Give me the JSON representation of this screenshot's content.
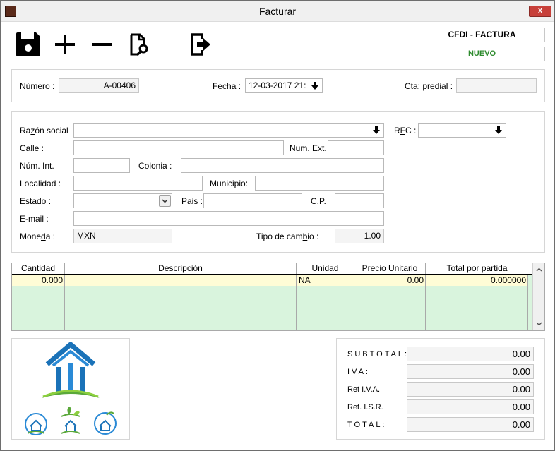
{
  "window": {
    "title": "Facturar",
    "close_label": "x"
  },
  "toolbar": {
    "save": "save-icon",
    "add": "plus-icon",
    "remove": "minus-icon",
    "preview": "document-search-icon",
    "exit": "exit-icon"
  },
  "doc": {
    "type": "CFDI - FACTURA",
    "status": "NUEVO",
    "status_color": "#2e8b2e"
  },
  "header": {
    "numero_label": "Número :",
    "numero_value": "A-00406",
    "fecha_label_pre": "Fec",
    "fecha_label_u": "h",
    "fecha_label_post": "a :",
    "fecha_value": "12-03-2017 21:",
    "cta_label_pre": "Cta: ",
    "cta_label_u": "p",
    "cta_label_post": "redial :",
    "cta_value": ""
  },
  "cliente": {
    "razon_label_pre": "Ra",
    "razon_label_u": "z",
    "razon_label_post": "ón social",
    "razon_value": "",
    "rfc_label_pre": "R",
    "rfc_label_u": "F",
    "rfc_label_post": "C :",
    "rfc_value": "",
    "calle_label": "Calle :",
    "calle_value": "",
    "numext_label": "Num. Ext.",
    "numext_value": "",
    "numint_label": "Núm. Int.",
    "numint_value": "",
    "colonia_label": "Colonia :",
    "colonia_value": "",
    "localidad_label": "Localidad :",
    "localidad_value": "",
    "municipio_label": "Municipio:",
    "municipio_value": "",
    "estado_label": "Estado :",
    "estado_value": "",
    "pais_label": "Pais :",
    "pais_value": "",
    "cp_label": "C.P.",
    "cp_value": "",
    "email_label": "E-mail :",
    "email_value": "",
    "moneda_label_pre": "Mone",
    "moneda_label_u": "d",
    "moneda_label_post": "a :",
    "moneda_value": "MXN",
    "tipo_label_pre": "Tipo de cam",
    "tipo_label_u": "b",
    "tipo_label_post": "io :",
    "tipo_value": "1.00"
  },
  "grid": {
    "columns": [
      "Cantidad",
      "Descripción",
      "Unidad",
      "Precio Unitario",
      "Total por partida"
    ],
    "rows": [
      {
        "cantidad": "0.000",
        "descripcion": "",
        "unidad": "NA",
        "precio": "0.00",
        "total": "0.000000"
      }
    ]
  },
  "totals": {
    "subtotal_label": "SUBTOTAL:",
    "subtotal_value": "0.00",
    "iva_label": "IVA:",
    "iva_value": "0.00",
    "ret_iva_label": "Ret I.V.A.",
    "ret_iva_value": "0.00",
    "ret_isr_label": "Ret. I.S.R.",
    "ret_isr_value": "0.00",
    "total_label": "TOTAL:",
    "total_value": "0.00"
  },
  "logo": {
    "name": "house-logo-icon"
  }
}
